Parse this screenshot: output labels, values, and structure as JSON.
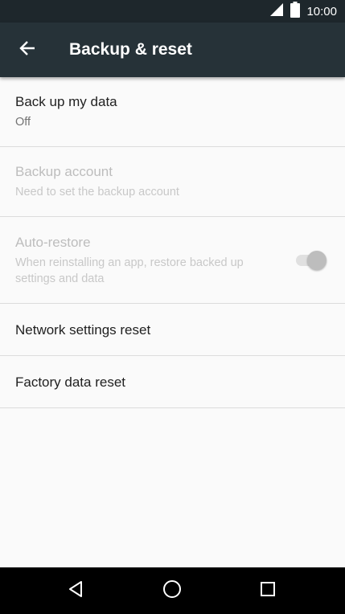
{
  "status_bar": {
    "time": "10:00",
    "icons": [
      "signal-icon",
      "battery-icon"
    ]
  },
  "app_bar": {
    "title": "Backup & reset",
    "back_icon": "arrow-back-icon"
  },
  "items": [
    {
      "title": "Back up my data",
      "summary": "Off",
      "enabled": true
    },
    {
      "title": "Backup account",
      "summary": "Need to set the backup account",
      "enabled": false
    },
    {
      "title": "Auto-restore",
      "summary": "When reinstalling an app, restore backed up settings and data",
      "enabled": false,
      "toggle": {
        "on": true
      }
    },
    {
      "title": "Network settings reset",
      "enabled": true
    },
    {
      "title": "Factory data reset",
      "enabled": true
    }
  ],
  "nav_bar": {
    "buttons": [
      "back-icon",
      "home-icon",
      "recents-icon"
    ]
  },
  "colors": {
    "status_bar": "#1e272c",
    "app_bar": "#263238",
    "background": "#fafafa",
    "divider": "#dcdcdc",
    "nav_bar": "#000000"
  }
}
